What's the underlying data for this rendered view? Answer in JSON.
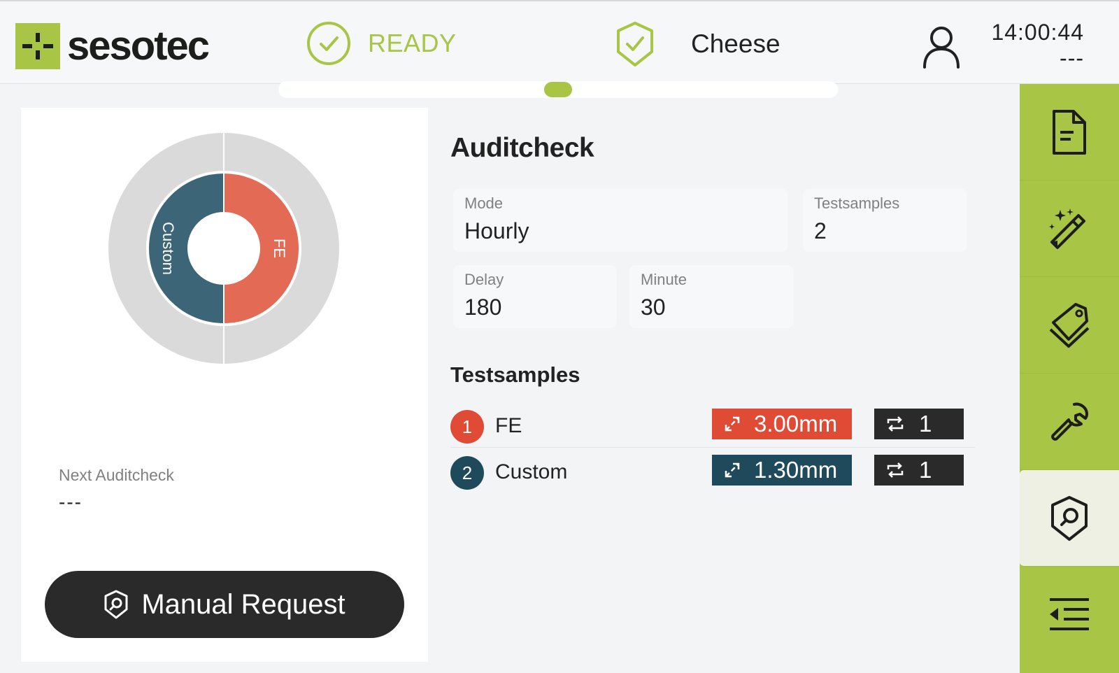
{
  "brand": {
    "name": "sesotec",
    "color": "#a8c545"
  },
  "header": {
    "status": "READY",
    "status_icon": "check-circle-icon",
    "product_icon": "shield-check-icon",
    "product": "Cheese",
    "user_icon": "user-icon",
    "time": "14:00:44",
    "subtime": "---"
  },
  "chart_data": {
    "type": "pie",
    "rings": [
      {
        "name": "outer",
        "slices": [
          {
            "label": "",
            "value": 50,
            "color": "#dadada"
          },
          {
            "label": "",
            "value": 50,
            "color": "#dadada"
          }
        ]
      },
      {
        "name": "inner",
        "slices": [
          {
            "label": "FE",
            "value": 50,
            "color": "#e36a55"
          },
          {
            "label": "Custom",
            "value": 50,
            "color": "#3d6578"
          }
        ]
      }
    ]
  },
  "left": {
    "next_label": "Next Auditcheck",
    "next_value": "---",
    "manual_button": "Manual Request",
    "manual_icon": "shield-search-icon"
  },
  "auditcheck": {
    "title": "Auditcheck",
    "fields": {
      "mode": {
        "label": "Mode",
        "value": "Hourly"
      },
      "testsamples": {
        "label": "Testsamples",
        "value": "2"
      },
      "delay": {
        "label": "Delay",
        "value": "180"
      },
      "minute": {
        "label": "Minute",
        "value": "30"
      }
    },
    "testsamples_title": "Testsamples",
    "samples": [
      {
        "num": "1",
        "name": "FE",
        "size": "3.00mm",
        "repeat": "1",
        "color": "#e04b35"
      },
      {
        "num": "2",
        "name": "Custom",
        "size": "1.30mm",
        "repeat": "1",
        "color": "#1f4a5c"
      }
    ]
  },
  "sidebar": {
    "items": [
      {
        "icon": "document-icon"
      },
      {
        "icon": "magic-wand-icon"
      },
      {
        "icon": "tags-icon"
      },
      {
        "icon": "wrench-icon"
      },
      {
        "icon": "shield-search-icon",
        "active": true
      },
      {
        "icon": "menu-collapse-icon"
      }
    ]
  }
}
